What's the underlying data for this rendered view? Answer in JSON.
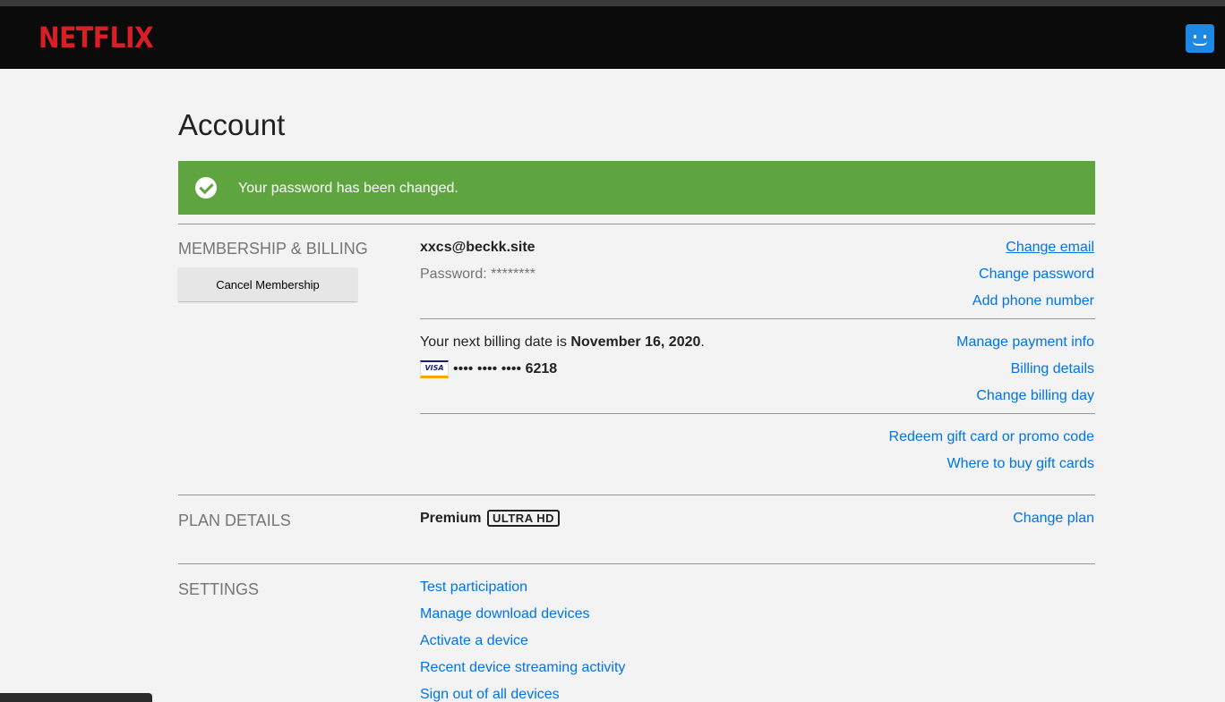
{
  "header": {
    "logo_text": "NETFLIX",
    "brand_color": "#d81f26",
    "avatar_icon": "smiley-avatar-icon"
  },
  "page": {
    "title": "Account"
  },
  "banner": {
    "message": "Your password has been changed.",
    "icon": "check-circle-icon",
    "color": "#5fa53f"
  },
  "membership": {
    "section_label": "MEMBERSHIP & BILLING",
    "cancel_button_label": "Cancel Membership",
    "email": "xxcs@beckk.site",
    "password_text": "Password: ********",
    "links": {
      "change_email": "Change email",
      "change_password": "Change password",
      "add_phone": "Add phone number"
    },
    "billing": {
      "prefix": "Your next billing date is ",
      "date": "November 16, 2020",
      "suffix": ".",
      "card_brand": "VISA",
      "card_mask": "•••• •••• ••••",
      "card_last4": "6218",
      "links": {
        "manage_payment": "Manage payment info",
        "billing_details": "Billing details",
        "change_billing_day": "Change billing day"
      }
    },
    "gift": {
      "redeem": "Redeem gift card or promo code",
      "where_to_buy": "Where to buy gift cards"
    }
  },
  "plan": {
    "section_label": "PLAN DETAILS",
    "plan_name": "Premium",
    "badge": "ULTRA HD",
    "change_plan": "Change plan"
  },
  "settings": {
    "section_label": "SETTINGS",
    "links": [
      "Test participation",
      "Manage download devices",
      "Activate a device",
      "Recent device streaming activity",
      "Sign out of all devices"
    ]
  },
  "link_color": "#0073e6"
}
